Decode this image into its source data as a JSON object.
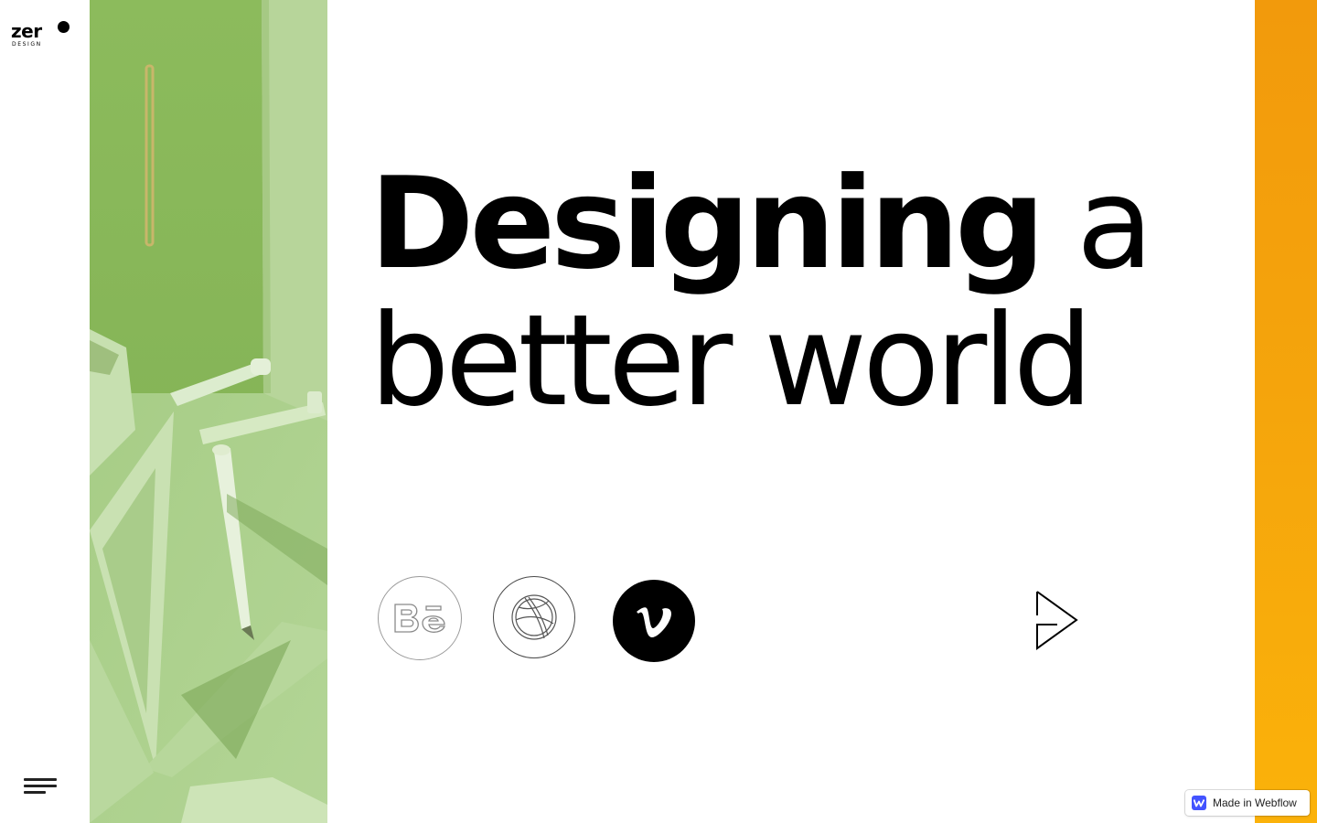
{
  "brand": {
    "name": "zer",
    "sub": "DESIGN"
  },
  "hero": {
    "line1_bold": "Designing",
    "line1_light": " a",
    "line2": "better world"
  },
  "social": [
    {
      "name": "Behance",
      "icon": "behance-icon"
    },
    {
      "name": "Dribbble",
      "icon": "dribbble-icon"
    },
    {
      "name": "Vimeo",
      "icon": "vimeo-icon"
    }
  ],
  "navigation": {
    "menu_icon": "hamburger-menu-icon",
    "next_icon": "play-arrow-icon"
  },
  "badge": {
    "label": "Made in Webflow",
    "icon": "webflow-icon"
  },
  "colors": {
    "background": "#ffffff",
    "text": "#000000",
    "photo_green": "#8fb961",
    "accent_orange": "#f5a50c",
    "webflow_blue": "#4353ff"
  }
}
